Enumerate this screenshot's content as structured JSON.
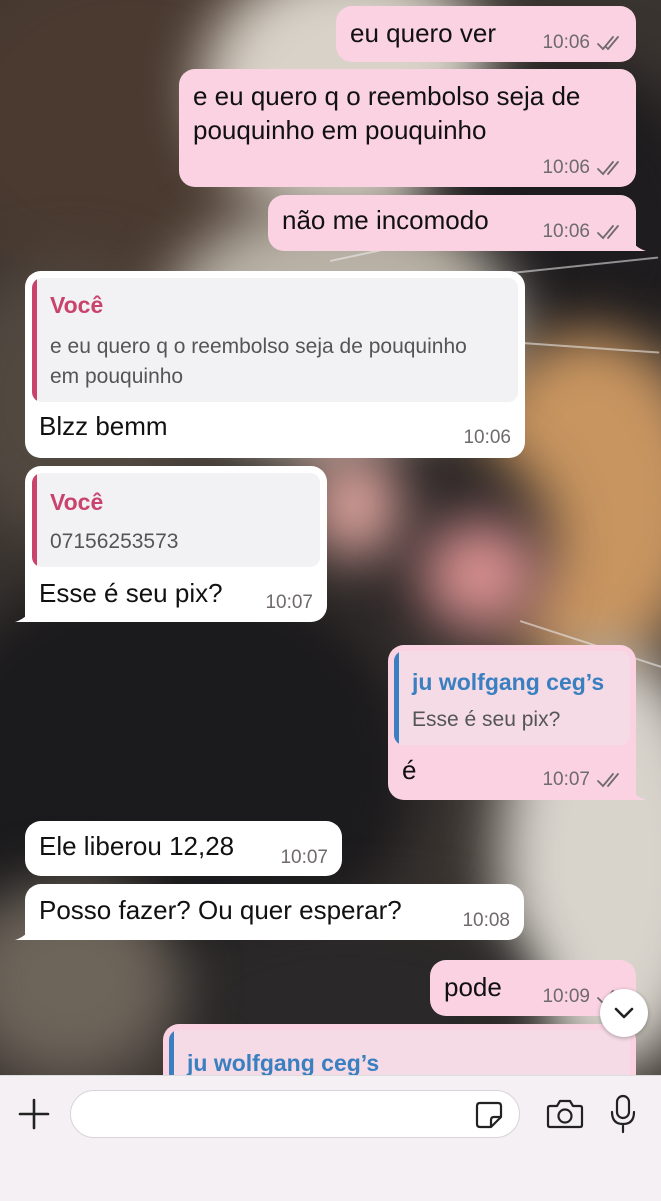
{
  "colors": {
    "outgoing_bubble": "#fad2e1",
    "incoming_bubble": "#ffffff",
    "quote_you": "#c9436d",
    "quote_contact": "#3a7fc0",
    "ticks": "#6f6a6d"
  },
  "messages": [
    {
      "text": "eu quero ver",
      "time": "10:06",
      "direction": "out",
      "read": true
    },
    {
      "text": "e eu quero q o reembolso seja de\npouquinho em pouquinho",
      "time": "10:06",
      "direction": "out",
      "read": true
    },
    {
      "text": "não me incomodo",
      "time": "10:06",
      "direction": "out",
      "read": true
    },
    {
      "quote_name": "Você",
      "quote_text": "e eu quero q o reembolso seja de pouquinho\nem pouquinho",
      "text": "Blzz bemm",
      "time": "10:06",
      "direction": "in"
    },
    {
      "quote_name": "Você",
      "quote_text": "07156253573",
      "text": "Esse é seu pix?",
      "time": "10:07",
      "direction": "in"
    },
    {
      "quote_name": "ju wolfgang ceg’s",
      "quote_text": "Esse é seu pix?",
      "text": "é",
      "time": "10:07",
      "direction": "out",
      "read": true
    },
    {
      "text": "Ele liberou 12,28",
      "time": "10:07",
      "direction": "in"
    },
    {
      "text": "Posso fazer? Ou quer esperar?",
      "time": "10:08",
      "direction": "in"
    },
    {
      "text": "pode",
      "time": "10:09",
      "direction": "out",
      "read": true
    },
    {
      "quote_name": "ju wolfgang ceg’s",
      "direction": "out"
    }
  ],
  "composer": {
    "placeholder": "",
    "icons": [
      "plus-icon",
      "sticker-icon",
      "camera-icon",
      "microphone-icon"
    ]
  },
  "scroll_button_icon": "chevron-down-icon"
}
